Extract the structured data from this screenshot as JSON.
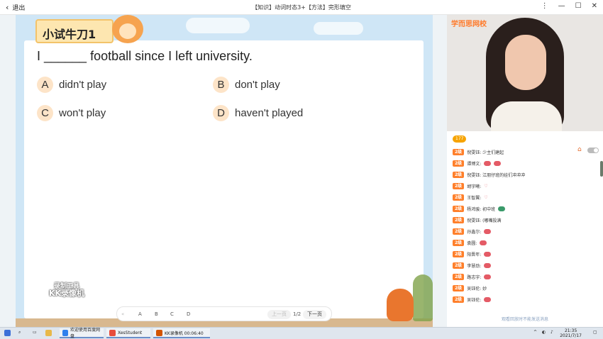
{
  "window": {
    "back_label": "退出",
    "title": "【知识】动词时态3+【方法】完形填空",
    "controls": [
      "⋮",
      "—",
      "☐",
      "✕"
    ]
  },
  "slide": {
    "tag_label": "小试牛刀1",
    "question": "I ______ football since I left university.",
    "options": [
      {
        "letter": "A",
        "text": "didn't play"
      },
      {
        "letter": "B",
        "text": "don't play"
      },
      {
        "letter": "C",
        "text": "won't play"
      },
      {
        "letter": "D",
        "text": "haven't played"
      }
    ],
    "answer_buttons": [
      "A",
      "B",
      "C",
      "D"
    ],
    "pager": {
      "prev": "上一页",
      "page": "1/2",
      "next": "下一页"
    },
    "watermark_line1": "录制工具",
    "watermark_line2": "KK录像机"
  },
  "live": {
    "video_logo": "学而思网校",
    "viewer_count": "177",
    "messages": [
      {
        "badge": "2级",
        "text": "倪雯钰: 少主们建起"
      },
      {
        "badge": "2级",
        "text": "谭博文:"
      },
      {
        "badge": "2级",
        "text": "倪雯钰: 江朋仔班的娃们冲冲冲"
      },
      {
        "badge": "2级",
        "text": "胡宇曦:"
      },
      {
        "badge": "2级",
        "text": "王智翼:"
      },
      {
        "badge": "2级",
        "text": "杨鸿骏: 初中班"
      },
      {
        "badge": "2级",
        "text": "倪雯钰: (嘟嘴投满"
      },
      {
        "badge": "2级",
        "text": "孙鑫尔:"
      },
      {
        "badge": "2级",
        "text": "袁圆:"
      },
      {
        "badge": "2级",
        "text": "阳晋年:"
      },
      {
        "badge": "2级",
        "text": "李慧劲:"
      },
      {
        "badge": "2级",
        "text": "路志宇:"
      },
      {
        "badge": "2级",
        "text": "吴钰伦: 妙"
      },
      {
        "badge": "2级",
        "text": "吴钰伦:"
      }
    ],
    "chat_hint": "观看回放时不能发送消息"
  },
  "taskbar": {
    "tasks": [
      {
        "label": "欢迎使用百度网盘"
      },
      {
        "label": "XesStudent"
      },
      {
        "label": "KK录像机 00:06:40"
      }
    ],
    "time": "21:35",
    "date": "2021/7/17"
  },
  "colors": {
    "accent": "#ff7f2a",
    "slide_bg": "#cfe6f6",
    "option_circle": "#fde4c8"
  }
}
